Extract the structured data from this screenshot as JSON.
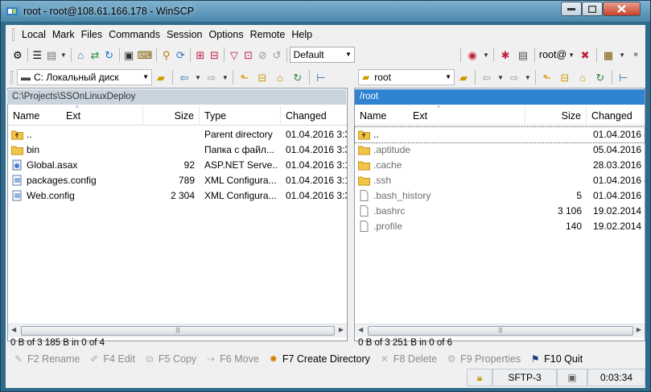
{
  "window": {
    "title": "root - root@108.61.166.178 - WinSCP"
  },
  "menu": [
    "Local",
    "Mark",
    "Files",
    "Commands",
    "Session",
    "Options",
    "Remote",
    "Help"
  ],
  "toolbar": {
    "transfer_preset": "Default",
    "session_label": "root@"
  },
  "left": {
    "drive_label": "C: Локальный диск",
    "path": "C:\\Projects\\SSOnLinuxDeploy",
    "columns": {
      "name": "Name",
      "ext": "Ext",
      "size": "Size",
      "type": "Type",
      "changed": "Changed"
    },
    "files": [
      {
        "icon": "parent-folder-icon",
        "name": "..",
        "size": "",
        "type": "Parent directory",
        "changed": "01.04.2016  3:3"
      },
      {
        "icon": "folder-icon",
        "name": "bin",
        "size": "",
        "type": "Папка с файл...",
        "changed": "01.04.2016  3:3"
      },
      {
        "icon": "asax-file-icon",
        "name": "Global.asax",
        "size": "92",
        "type": "ASP.NET Serve...",
        "changed": "01.04.2016  3:1"
      },
      {
        "icon": "config-file-icon",
        "name": "packages.config",
        "size": "789",
        "type": "XML Configura...",
        "changed": "01.04.2016  3:1"
      },
      {
        "icon": "config-file-icon",
        "name": "Web.config",
        "size": "2 304",
        "type": "XML Configura...",
        "changed": "01.04.2016  3:3"
      }
    ],
    "status": "0 B of 3 185 B in 0 of 4"
  },
  "right": {
    "dir_label": "root",
    "path": "/root",
    "columns": {
      "name": "Name",
      "ext": "Ext",
      "size": "Size",
      "changed": "Changed"
    },
    "files": [
      {
        "icon": "parent-folder-icon",
        "name": "..",
        "size": "",
        "changed": "01.04.2016 4"
      },
      {
        "icon": "folder-icon",
        "name": ".aptitude",
        "size": "",
        "changed": "05.04.2016 2"
      },
      {
        "icon": "folder-icon",
        "name": ".cache",
        "size": "",
        "changed": "28.03.2016 1"
      },
      {
        "icon": "folder-icon",
        "name": ".ssh",
        "size": "",
        "changed": "01.04.2016 4"
      },
      {
        "icon": "file-icon",
        "name": ".bash_history",
        "size": "5",
        "changed": "01.04.2016 6"
      },
      {
        "icon": "file-icon",
        "name": ".bashrc",
        "size": "3 106",
        "changed": "19.02.2014 1"
      },
      {
        "icon": "file-icon",
        "name": ".profile",
        "size": "140",
        "changed": "19.02.2014 1"
      }
    ],
    "status": "0 B of 3 251 B in 0 of 6"
  },
  "fkeys": [
    {
      "label": "F2 Rename",
      "enabled": false,
      "icon": "rename-icon"
    },
    {
      "label": "F4 Edit",
      "enabled": false,
      "icon": "edit-icon"
    },
    {
      "label": "F5 Copy",
      "enabled": false,
      "icon": "copy-icon"
    },
    {
      "label": "F6 Move",
      "enabled": false,
      "icon": "move-icon"
    },
    {
      "label": "F7 Create Directory",
      "enabled": true,
      "icon": "create-directory-icon"
    },
    {
      "label": "F8 Delete",
      "enabled": false,
      "icon": "delete-icon"
    },
    {
      "label": "F9 Properties",
      "enabled": false,
      "icon": "properties-icon"
    },
    {
      "label": "F10 Quit",
      "enabled": true,
      "icon": "quit-icon"
    }
  ],
  "statusbar": {
    "protocol": "SFTP-3",
    "elapsed": "0:03:34"
  }
}
